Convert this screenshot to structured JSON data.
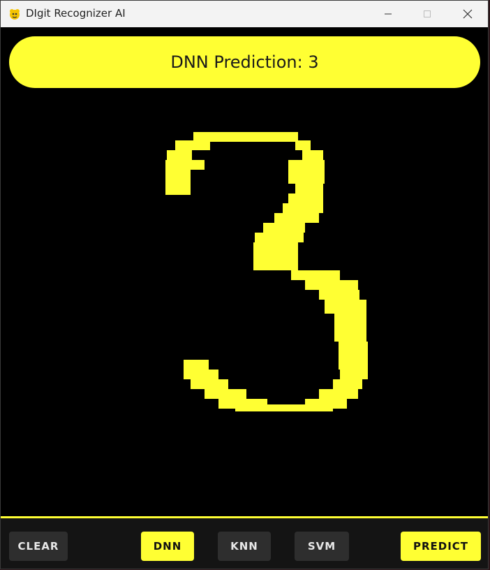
{
  "window": {
    "title": "DIgit Recognizer AI",
    "app_icon": "pygame-snake-icon",
    "controls": [
      "minimize-icon",
      "maximize-icon",
      "close-icon"
    ]
  },
  "banner": {
    "text": "DNN Prediction: 3"
  },
  "canvas": {
    "drawn_digit": "3",
    "stroke_color": "#ffff33",
    "background_color": "#000000"
  },
  "toolbar": {
    "clear_label": "CLEAR",
    "dnn_label": "DNN",
    "knn_label": "KNN",
    "svm_label": "SVM",
    "predict_label": "PREDICT",
    "selected_model": "DNN"
  },
  "colors": {
    "accent": "#ffff33",
    "toolbar_bg": "#141414",
    "button_dark": "#2e2e2e"
  }
}
